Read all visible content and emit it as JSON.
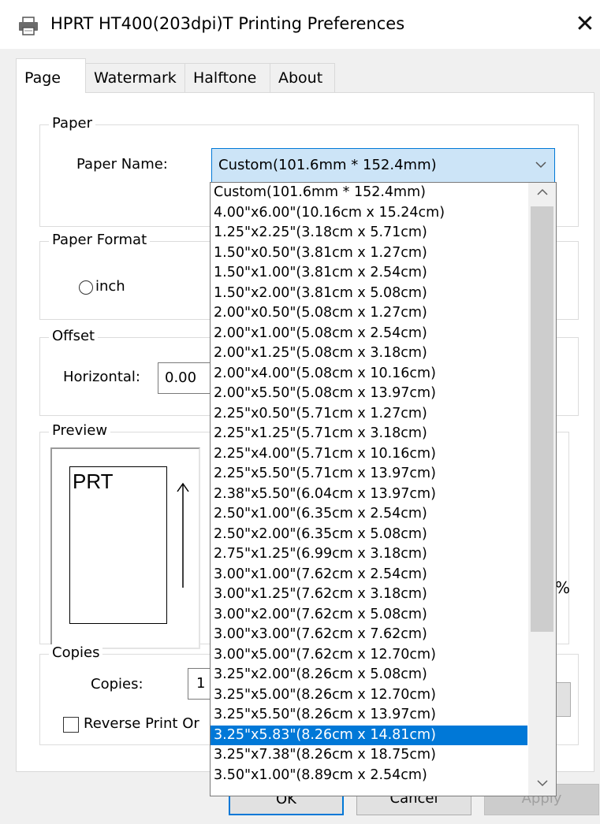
{
  "window": {
    "title": "HPRT HT400(203dpi)T Printing Preferences",
    "close_glyph": "✕"
  },
  "tabs": [
    {
      "label": "Page",
      "active": true
    },
    {
      "label": "Watermark",
      "active": false
    },
    {
      "label": "Halftone",
      "active": false
    },
    {
      "label": "About",
      "active": false
    }
  ],
  "paper": {
    "group_label": "Paper",
    "name_label": "Paper Name:",
    "selected_value": "Custom(101.6mm * 152.4mm)"
  },
  "paper_format": {
    "group_label": "Paper Format",
    "inch_label": "inch"
  },
  "offset": {
    "group_label": "Offset",
    "horizontal_label": "Horizontal:",
    "horizontal_value": "0.00"
  },
  "preview": {
    "group_label": "Preview",
    "paper_text": "PRT",
    "percent_fragment": "%"
  },
  "copies": {
    "group_label": "Copies",
    "copies_label": "Copies:",
    "copies_value": "1",
    "reverse_label": "Reverse Print Or"
  },
  "buttons": {
    "ok": "OK",
    "cancel": "Cancel",
    "apply": "Apply"
  },
  "dropdown": {
    "selected_index": 27,
    "items": [
      "Custom(101.6mm * 152.4mm)",
      "4.00\"x6.00\"(10.16cm x 15.24cm)",
      "1.25\"x2.25\"(3.18cm x 5.71cm)",
      "1.50\"x0.50\"(3.81cm x 1.27cm)",
      "1.50\"x1.00\"(3.81cm x 2.54cm)",
      "1.50\"x2.00\"(3.81cm x 5.08cm)",
      "2.00\"x0.50\"(5.08cm x 1.27cm)",
      "2.00\"x1.00\"(5.08cm x 2.54cm)",
      "2.00\"x1.25\"(5.08cm x 3.18cm)",
      "2.00\"x4.00\"(5.08cm x 10.16cm)",
      "2.00\"x5.50\"(5.08cm x 13.97cm)",
      "2.25\"x0.50\"(5.71cm x 1.27cm)",
      "2.25\"x1.25\"(5.71cm x 3.18cm)",
      "2.25\"x4.00\"(5.71cm x 10.16cm)",
      "2.25\"x5.50\"(5.71cm x 13.97cm)",
      "2.38\"x5.50\"(6.04cm x 13.97cm)",
      "2.50\"x1.00\"(6.35cm x 2.54cm)",
      "2.50\"x2.00\"(6.35cm x 5.08cm)",
      "2.75\"x1.25\"(6.99cm x 3.18cm)",
      "3.00\"x1.00\"(7.62cm x 2.54cm)",
      "3.00\"x1.25\"(7.62cm x 3.18cm)",
      "3.00\"x2.00\"(7.62cm x 5.08cm)",
      "3.00\"x3.00\"(7.62cm x 7.62cm)",
      "3.00\"x5.00\"(7.62cm x 12.70cm)",
      "3.25\"x2.00\"(8.26cm x 5.08cm)",
      "3.25\"x5.00\"(8.26cm x 12.70cm)",
      "3.25\"x5.50\"(8.26cm x 13.97cm)",
      "3.25\"x5.83\"(8.26cm x 14.81cm)",
      "3.25\"x7.38\"(8.26cm x 18.75cm)",
      "3.50\"x1.00\"(8.89cm x 2.54cm)"
    ]
  },
  "colors": {
    "accent": "#0078d7",
    "combo_bg": "#cce4f7",
    "dialog_bg": "#f0f0f0",
    "panel_bg": "#ffffff"
  }
}
